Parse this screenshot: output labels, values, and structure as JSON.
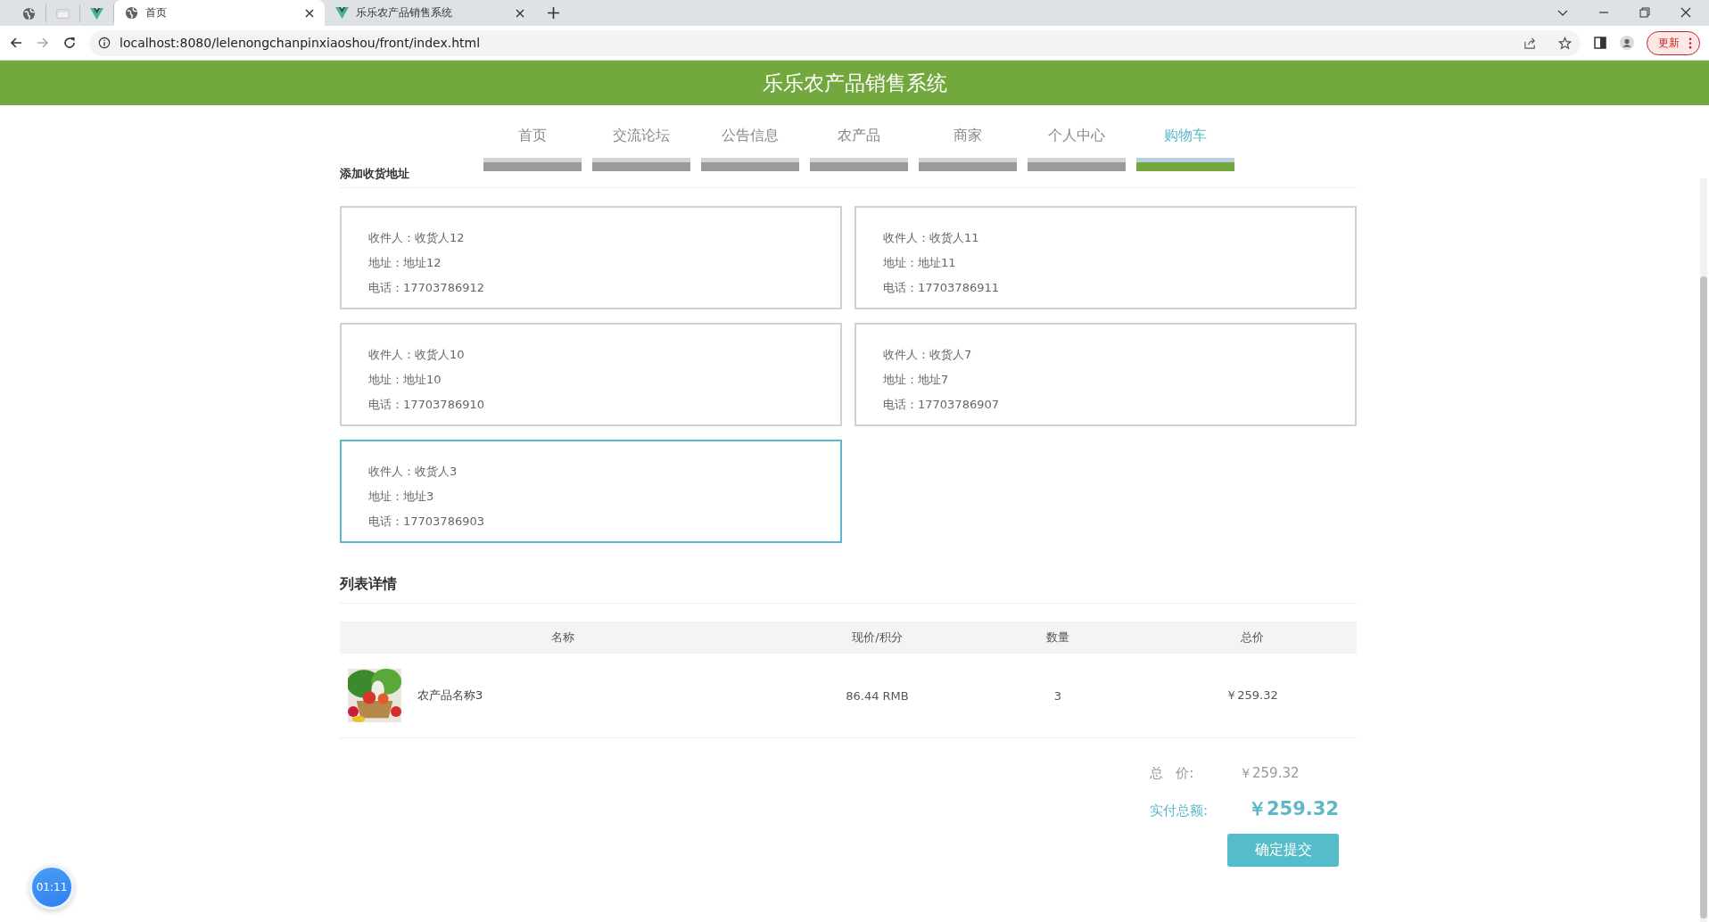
{
  "browser": {
    "tabs": [
      {
        "kind": "globe",
        "selected": false
      },
      {
        "kind": "page",
        "selected": false
      },
      {
        "kind": "vue",
        "selected": false
      },
      {
        "kind": "globe",
        "title": "首页",
        "selected": true
      },
      {
        "kind": "vue",
        "title": "乐乐农产品销售系统",
        "selected": false
      }
    ],
    "url": "localhost:8080/lelenongchanpinxiaoshou/front/index.html",
    "update_button": "更新"
  },
  "header": {
    "title": "乐乐农产品销售系统"
  },
  "nav": [
    {
      "label": "首页",
      "selected": false
    },
    {
      "label": "交流论坛",
      "selected": false
    },
    {
      "label": "公告信息",
      "selected": false
    },
    {
      "label": "农产品",
      "selected": false
    },
    {
      "label": "商家",
      "selected": false
    },
    {
      "label": "个人中心",
      "selected": false
    },
    {
      "label": "购物车",
      "selected": true
    }
  ],
  "address_section": {
    "title": "添加收货地址",
    "addresses": [
      {
        "lines": [
          "收件人：收货人12",
          "地址：地址12",
          "电话：17703786912"
        ],
        "selected": false
      },
      {
        "lines": [
          "收件人：收货人11",
          "地址：地址11",
          "电话：17703786911"
        ],
        "selected": false
      },
      {
        "lines": [
          "收件人：收货人10",
          "地址：地址10",
          "电话：17703786910"
        ],
        "selected": false
      },
      {
        "lines": [
          "收件人：收货人7",
          "地址：地址7",
          "电话：17703786907"
        ],
        "selected": false
      },
      {
        "lines": [
          "收件人：收货人3",
          "地址：地址3",
          "电话：17703786903"
        ],
        "selected": true
      }
    ]
  },
  "list_section": {
    "title": "列表详情",
    "table": {
      "columns": [
        "名称",
        "现价/积分",
        "数量",
        "总价"
      ],
      "rows": [
        {
          "name": "农产品名称3",
          "price": "86.44 RMB",
          "quantity": "3",
          "total": "￥259.32"
        }
      ]
    }
  },
  "summary": {
    "total_label": "总   价:",
    "total": "￥259.32",
    "paid_label": "实付总额:",
    "paid": "￥259.32",
    "submit_button": "确定提交"
  },
  "timer": "01:11"
}
